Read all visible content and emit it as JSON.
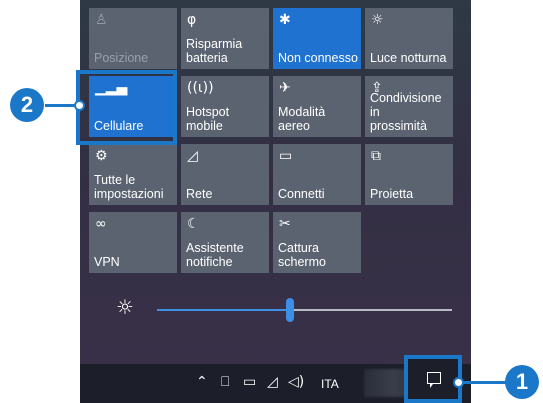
{
  "colors": {
    "accent": "#1f72cf",
    "tile": "#5b6371",
    "callout": "#1b78c8"
  },
  "tiles": [
    {
      "label": "Posizione",
      "icon": "location-icon",
      "glyph": "♙",
      "active": false,
      "dim": true
    },
    {
      "label": "Risparmia\nbatteria",
      "icon": "battery-saver-icon",
      "glyph": "φ",
      "active": false,
      "dim": false
    },
    {
      "label": "Non connesso",
      "icon": "bluetooth-icon",
      "glyph": "✱",
      "active": true,
      "dim": false
    },
    {
      "label": "Luce notturna",
      "icon": "night-light-icon",
      "glyph": "☼",
      "active": false,
      "dim": false
    },
    {
      "label": "Cellulare",
      "icon": "cellular-signal-icon",
      "glyph": "▁▂▄",
      "active": true,
      "dim": false
    },
    {
      "label": "Hotspot mobile",
      "icon": "hotspot-icon",
      "glyph": "((ι))",
      "active": false,
      "dim": false
    },
    {
      "label": "Modalità aereo",
      "icon": "airplane-icon",
      "glyph": "✈",
      "active": false,
      "dim": false
    },
    {
      "label": "Condivisione in\nprossimità",
      "icon": "nearby-sharing-icon",
      "glyph": "⇪",
      "active": false,
      "dim": false
    },
    {
      "label": "Tutte le\nimpostazioni",
      "icon": "settings-gear-icon",
      "glyph": "⚙",
      "active": false,
      "dim": false
    },
    {
      "label": "Rete",
      "icon": "network-icon",
      "glyph": "◿",
      "active": false,
      "dim": false
    },
    {
      "label": "Connetti",
      "icon": "connect-icon",
      "glyph": "▭",
      "active": false,
      "dim": false
    },
    {
      "label": "Proietta",
      "icon": "project-icon",
      "glyph": "⧉",
      "active": false,
      "dim": false
    },
    {
      "label": "VPN",
      "icon": "vpn-icon",
      "glyph": "∞",
      "active": false,
      "dim": false
    },
    {
      "label": "Assistente\nnotifiche",
      "icon": "focus-assist-icon",
      "glyph": "☾",
      "active": false,
      "dim": false
    },
    {
      "label": "Cattura\nschermo",
      "icon": "screen-snip-icon",
      "glyph": "✂",
      "active": false,
      "dim": false
    }
  ],
  "brightness": {
    "icon": "brightness-icon",
    "level": 0.45
  },
  "tray": {
    "icons": [
      "chevron-up-icon",
      "touch-keyboard-icon",
      "battery-icon",
      "wifi-icon",
      "volume-icon"
    ],
    "glyphs": [
      "⌃",
      "⌨",
      "▭",
      "◿",
      "🕪"
    ],
    "language": "ITA"
  },
  "callouts": {
    "one": "1",
    "two": "2"
  }
}
